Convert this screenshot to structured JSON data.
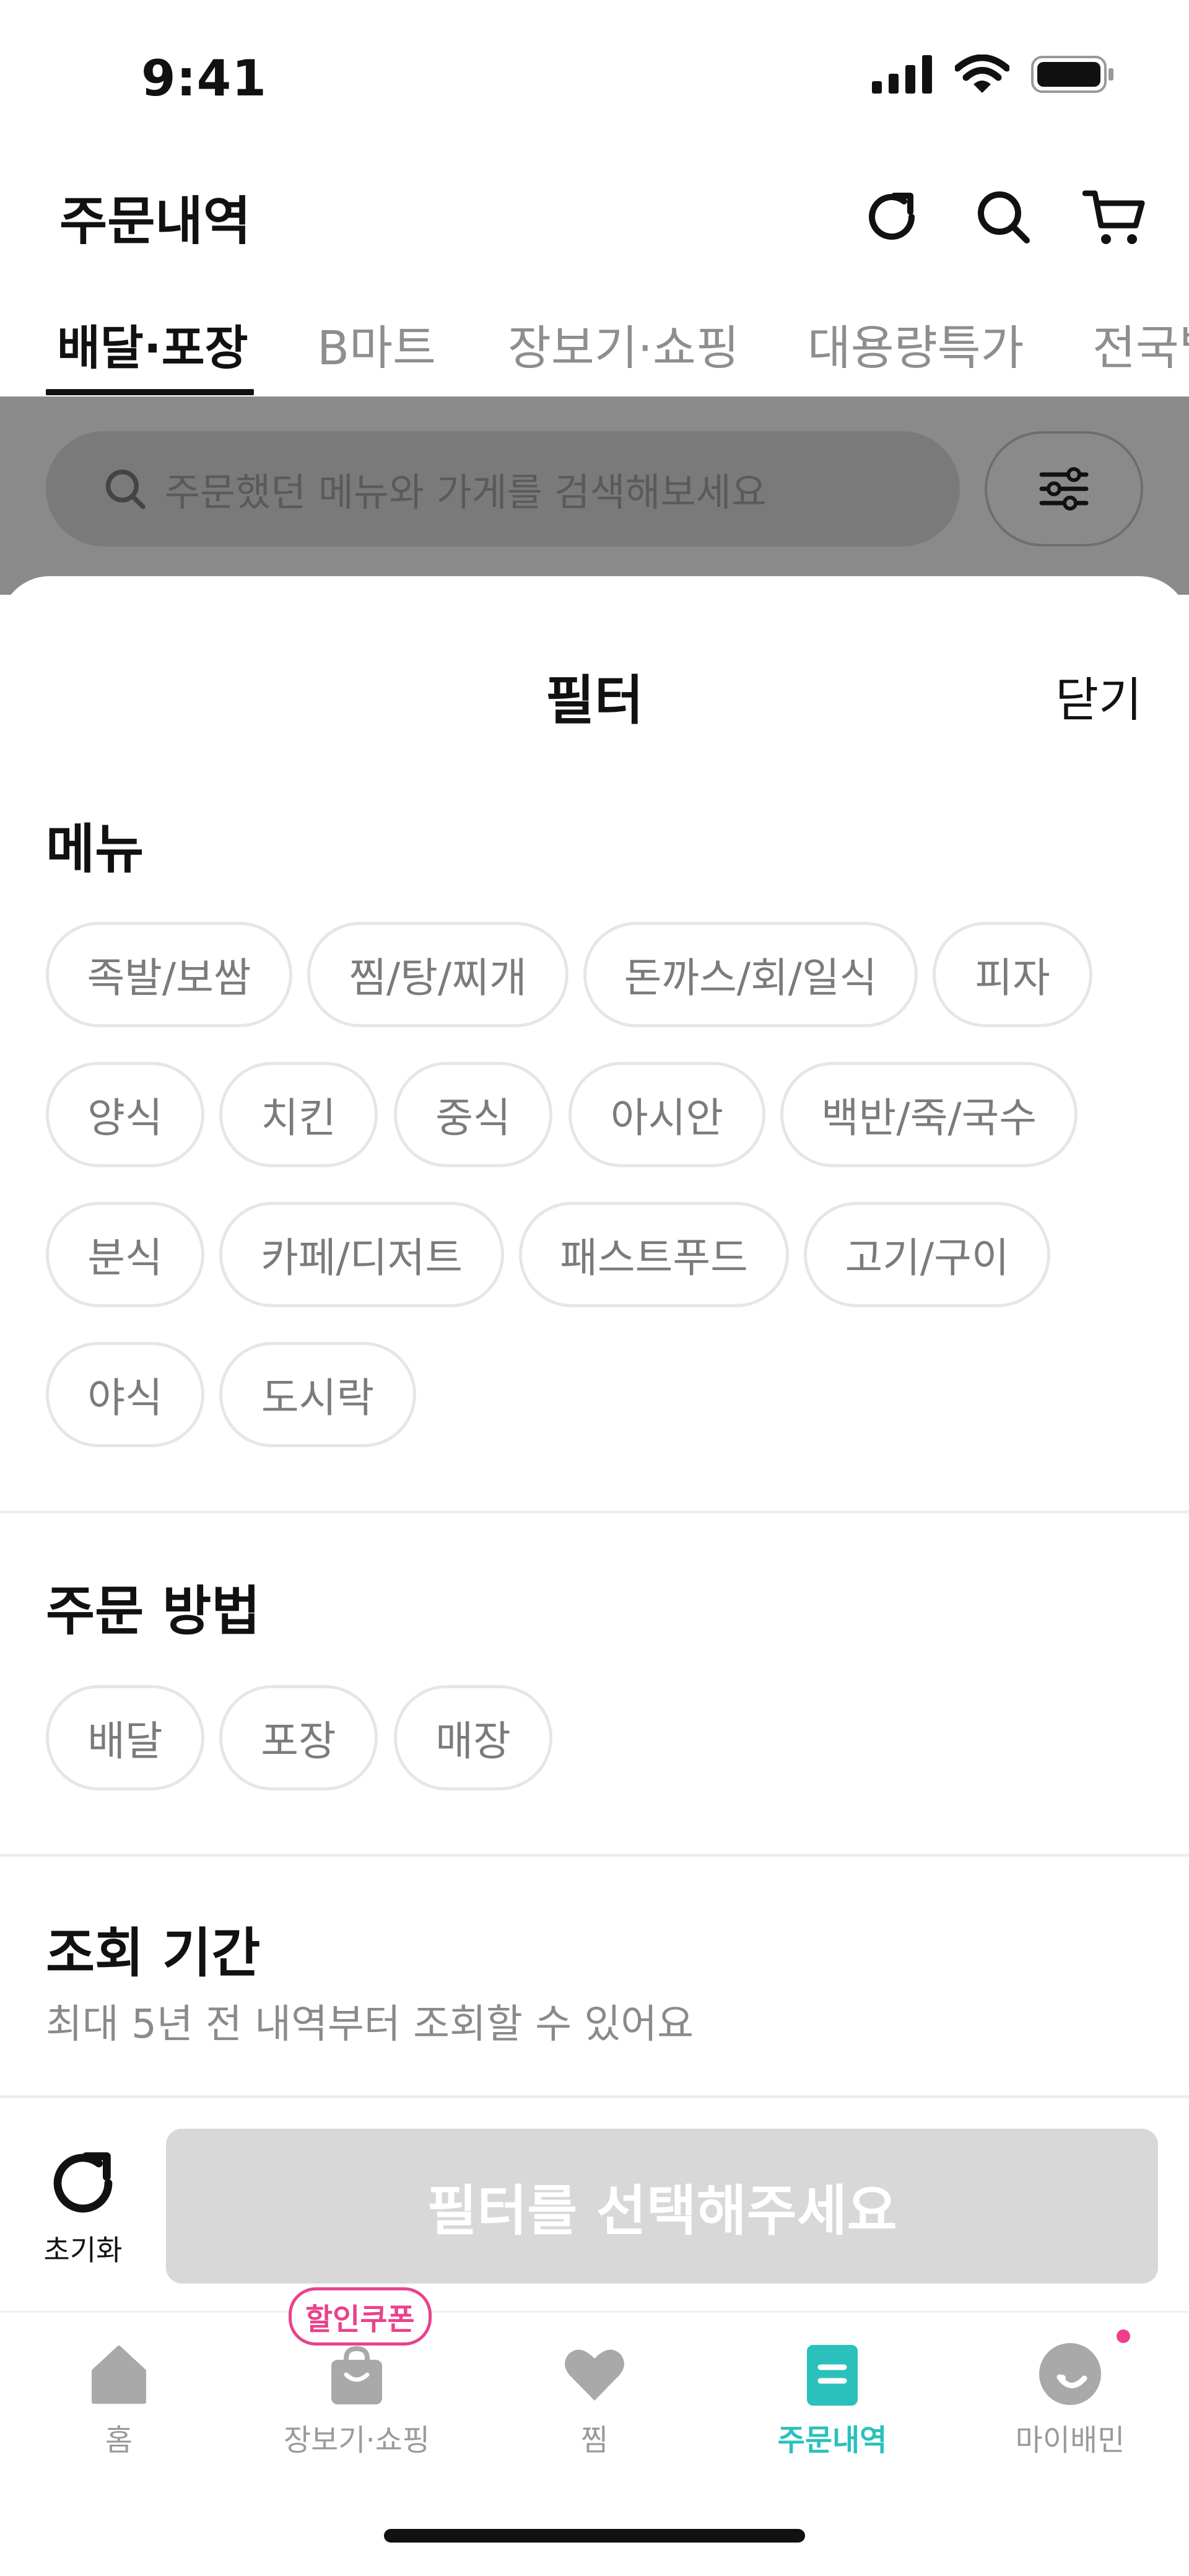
{
  "status_bar": {
    "time": "9:41"
  },
  "header": {
    "title": "주문내역"
  },
  "tabs": [
    {
      "label": "배달·포장",
      "active": true
    },
    {
      "label": "B마트",
      "active": false
    },
    {
      "label": "장보기·쇼핑",
      "active": false
    },
    {
      "label": "대용량특가",
      "active": false
    },
    {
      "label": "전국별",
      "active": false
    }
  ],
  "search": {
    "placeholder": "주문했던 메뉴와 가게를 검색해보세요"
  },
  "filter_sheet": {
    "title": "필터",
    "close_label": "닫기",
    "menu_section": {
      "title": "메뉴",
      "chips": [
        "족발/보쌈",
        "찜/탕/찌개",
        "돈까스/회/일식",
        "피자",
        "양식",
        "치킨",
        "중식",
        "아시안",
        "백반/죽/국수",
        "분식",
        "카페/디저트",
        "패스트푸드",
        "고기/구이",
        "야식",
        "도시락"
      ]
    },
    "order_method_section": {
      "title": "주문 방법",
      "chips": [
        "배달",
        "포장",
        "매장"
      ]
    },
    "period_section": {
      "title": "조회 기간",
      "description": "최대 5년 전 내역부터 조회할 수 있어요"
    },
    "reset_label": "초기화",
    "apply_label": "필터를 선택해주세요"
  },
  "bottom_nav": {
    "coupon_badge": "할인쿠폰",
    "items": [
      {
        "label": "홈",
        "icon": "home-icon",
        "active": false
      },
      {
        "label": "장보기·쇼핑",
        "icon": "shopping-bag-icon",
        "active": false
      },
      {
        "label": "찜",
        "icon": "heart-icon",
        "active": false
      },
      {
        "label": "주문내역",
        "icon": "order-list-icon",
        "active": true
      },
      {
        "label": "마이배민",
        "icon": "profile-icon",
        "active": false
      }
    ]
  },
  "colors": {
    "accent": "#2ac1bc",
    "badge": "#e8438c",
    "dim_overlay": "#8a8a8a",
    "disabled_button": "#d8d8d8"
  }
}
